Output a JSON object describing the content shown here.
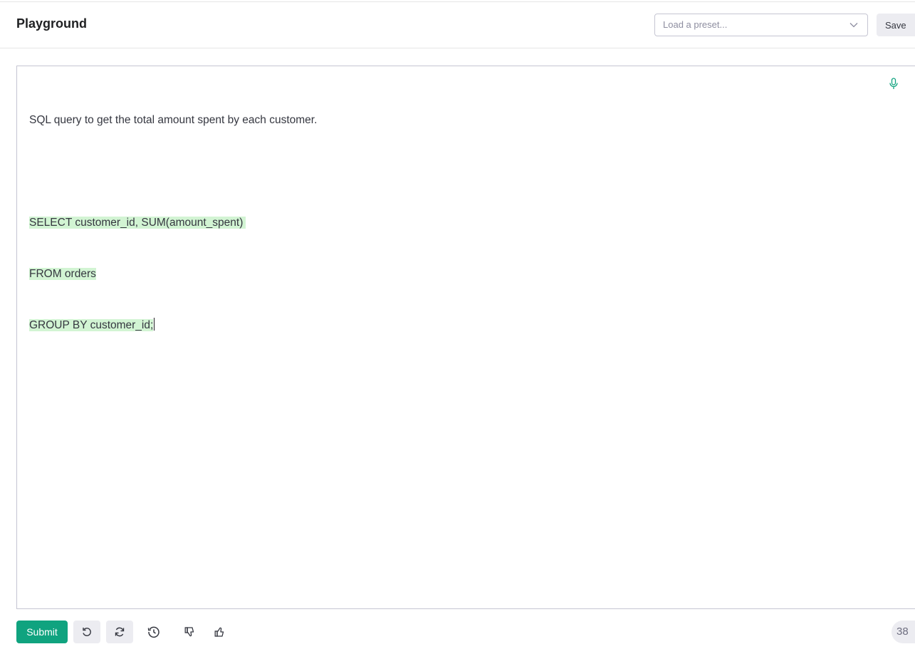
{
  "header": {
    "title": "Playground",
    "preset_placeholder": "Load a preset...",
    "save_label": "Save"
  },
  "editor": {
    "prompt_line": "SQL query to get the total amount spent by each customer.",
    "completion_lines": [
      "SELECT customer_id, SUM(amount_spent)",
      "FROM orders",
      "GROUP BY customer_id;"
    ],
    "completion_highlight_color": "#d2f4d3"
  },
  "footer": {
    "submit_label": "Submit",
    "token_count": "38"
  },
  "colors": {
    "accent": "#10a37f",
    "button_gray": "#ececf1"
  },
  "icons": {
    "mic": "microphone-icon",
    "undo": "undo-icon",
    "regenerate": "regenerate-icon",
    "history": "history-icon",
    "thumb_down": "thumbs-down-icon",
    "thumb_up": "thumbs-up-icon",
    "dropdown": "chevron-down-icon"
  }
}
